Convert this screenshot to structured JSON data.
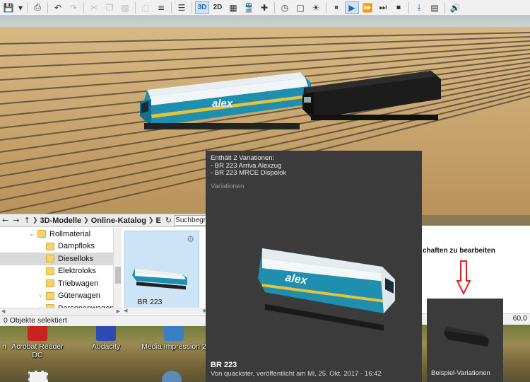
{
  "toolbar": {
    "items": [
      {
        "name": "save-icon",
        "glyph": "💾"
      },
      {
        "name": "dropdown-icon",
        "glyph": "▾"
      },
      {
        "name": "print-icon",
        "glyph": "⎙"
      },
      {
        "name": "undo-icon",
        "glyph": "↶"
      },
      {
        "name": "redo-icon",
        "glyph": "↷"
      },
      {
        "name": "cut-icon",
        "glyph": "✂"
      },
      {
        "name": "copy-icon",
        "glyph": "❐"
      },
      {
        "name": "paste-icon",
        "glyph": "📋"
      },
      {
        "name": "select-icon",
        "glyph": "⬚"
      },
      {
        "name": "align-icon",
        "glyph": "☰"
      },
      {
        "name": "layers-icon",
        "glyph": "≣"
      }
    ],
    "view_3d": "3D",
    "view_2d": "2D",
    "playback": {
      "pause": "⏸",
      "play": "▶",
      "ffwd": "⏩",
      "fastest": "⏭",
      "stop": "⏹"
    }
  },
  "browser": {
    "breadcrumbs": [
      "3D-Modelle",
      "Online-Katalog",
      "E"
    ],
    "search_placeholder": "Suchbegriff",
    "tree": [
      {
        "label": "Rollmaterial",
        "level": 2,
        "twist": "⌄"
      },
      {
        "label": "Dampfloks",
        "level": 3,
        "twist": ""
      },
      {
        "label": "Dieselloks",
        "level": 3,
        "twist": "",
        "selected": true
      },
      {
        "label": "Elektroloks",
        "level": 3,
        "twist": ""
      },
      {
        "label": "Triebwagen",
        "level": 3,
        "twist": ""
      },
      {
        "label": "Güterwagen",
        "level": 3,
        "twist": "›"
      },
      {
        "label": "Personenwagen",
        "level": 3,
        "twist": "›"
      }
    ],
    "tile_label": "BR 223",
    "status": "0 Objekte selektiert"
  },
  "rightwin": {
    "hint": "chaften zu bearbeiten",
    "zoom": "60,0"
  },
  "popup": {
    "info_heading": "Enthält 2 Variationen:",
    "info_lines": [
      "- BR 223 Arriva Alexzug",
      "- BR 223 MRCE Dispolok"
    ],
    "section_label": "Variationen",
    "title": "BR 223",
    "meta": "Von quackster, veröffentlicht am Mi, 25. Okt. 2017 - 16:42",
    "variation_label": "Beispiel-Variationen",
    "loco_brand": "alex"
  },
  "desktop": {
    "icons": [
      {
        "label": "n"
      },
      {
        "label": "Acrobat Reader DC"
      },
      {
        "label": "Audacity"
      },
      {
        "label": "Media Impression 2"
      }
    ]
  },
  "colors": {
    "loco_teal": "#1f8fb0",
    "loco_white": "#f2f5f7",
    "loco_yellow": "#e8c33a",
    "black_loco": "#1c1c1c",
    "sky": "#c8d4dc",
    "ground": "#c9a46a",
    "popup_bg": "#3b3b3b",
    "selection": "#d9d9d9",
    "tile_bg": "#cde3f6"
  }
}
